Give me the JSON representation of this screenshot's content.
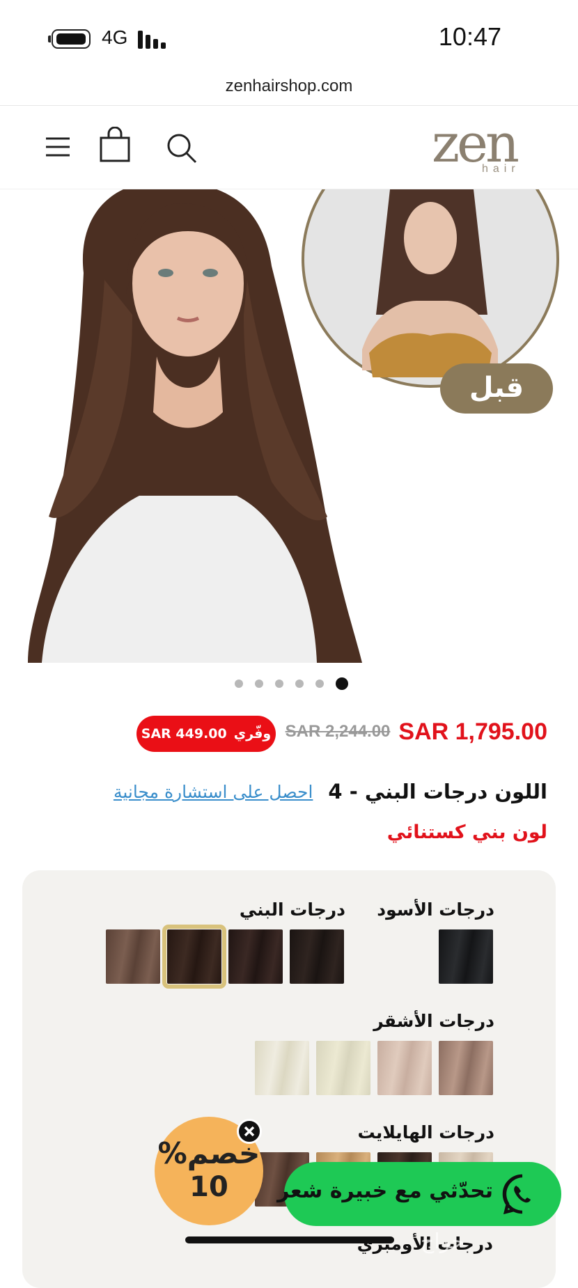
{
  "status_bar": {
    "network": "4G",
    "time": "10:47"
  },
  "browser": {
    "url": "zenhairshop.com"
  },
  "header": {
    "logo_mark": "zen",
    "logo_sub": "hair",
    "menu_icon": "menu-icon",
    "cart_icon": "shopping-bag-icon",
    "search_icon": "search-icon"
  },
  "hero": {
    "before_label": "قبل",
    "slide_count": 6,
    "active_slide": 6
  },
  "pricing": {
    "price": "SAR 1,795.00",
    "old_price": "SAR 2,244.00",
    "save_label": "وفّري",
    "save_amount": "SAR 449.00"
  },
  "product": {
    "color_label": "اللون درجات البني - 4",
    "consult_link": "احصل على استشارة مجانية",
    "color_name": "لون بني كستنائي"
  },
  "swatch_groups": [
    {
      "title": "درجات الأسود",
      "swatches": [
        {
          "color": "#141517",
          "color2": "#2a2c2f"
        }
      ]
    },
    {
      "title": "درجات البني",
      "swatches": [
        {
          "color": "#1a1412",
          "color2": "#2f2420"
        },
        {
          "color": "#201513",
          "color2": "#3a2824"
        },
        {
          "color": "#251712",
          "color2": "#3d2a22",
          "selected": true
        },
        {
          "color": "#5a4136",
          "color2": "#7b5e50"
        }
      ]
    },
    {
      "title": "درجات الأشقر",
      "swatches": [
        {
          "color": "#8c6e61",
          "color2": "#b89888"
        },
        {
          "color": "#c8aea0",
          "color2": "#e0cbbd"
        },
        {
          "color": "#d8d5bd",
          "color2": "#ece9d2"
        },
        {
          "color": "#dcd8c2",
          "color2": "#efece0"
        }
      ]
    },
    {
      "title": "درجات الهايلايت",
      "swatches": [
        {
          "color": "#c9b8a4",
          "color2": "#e3d5c3"
        },
        {
          "color": "#2a1e19",
          "color2": "#4a352c"
        },
        {
          "color": "#b48a58",
          "color2": "#d9b07c"
        },
        {
          "color": "#4a3329",
          "color2": "#6f5143"
        }
      ]
    }
  ],
  "next_group_title": "درجات الأومبري",
  "promo": {
    "discount_line1": "خصم%",
    "discount_line2": "10",
    "close_icon": "close-icon"
  },
  "whatsapp": {
    "label": "تحدّثي مع خبيرة شعر",
    "icon": "whatsapp-icon"
  },
  "colors": {
    "accent_red": "#e1121b",
    "whatsapp_green": "#1ec955",
    "gold": "#8b7a5a",
    "link_blue": "#3a8ecb"
  }
}
